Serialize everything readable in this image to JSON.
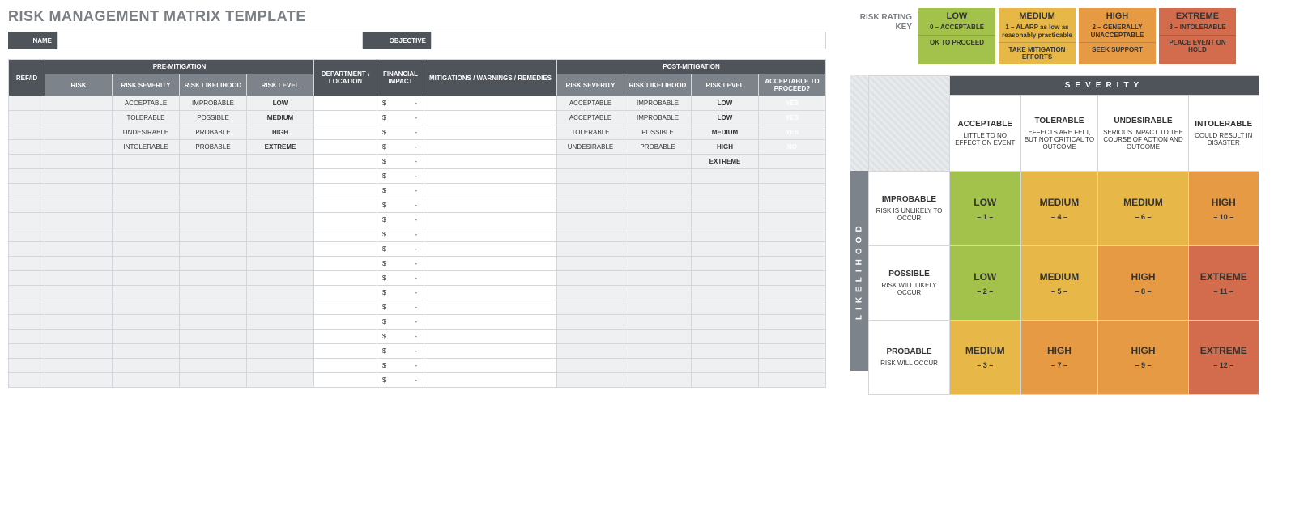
{
  "title": "RISK MANAGEMENT MATRIX TEMPLATE",
  "labels": {
    "name": "NAME",
    "objective": "OBJECTIVE"
  },
  "headers": {
    "refid": "REF/ID",
    "pre": "PRE-MITIGATION",
    "risk": "RISK",
    "sev": "RISK SEVERITY",
    "like": "RISK LIKELIHOOD",
    "level": "RISK LEVEL",
    "dept": "DEPARTMENT / LOCATION",
    "fin": "FINANCIAL IMPACT",
    "mit": "MITIGATIONS / WARNINGS / REMEDIES",
    "post": "POST-MITIGATION",
    "proc": "ACCEPTABLE TO PROCEED?"
  },
  "fin_prefix": "$",
  "fin_dash": "-",
  "rows": [
    {
      "pre_sev": "ACCEPTABLE",
      "pre_sev_cls": "acc",
      "pre_like": "IMPROBABLE",
      "pre_like_cls": "imp",
      "pre_level": "LOW",
      "pre_level_cls": "low",
      "post_sev": "ACCEPTABLE",
      "post_sev_cls": "acc",
      "post_like": "IMPROBABLE",
      "post_like_cls": "imp",
      "post_level": "LOW",
      "post_level_cls": "low",
      "proc": "YES",
      "proc_cls": "yes"
    },
    {
      "pre_sev": "TOLERABLE",
      "pre_sev_cls": "tol",
      "pre_like": "POSSIBLE",
      "pre_like_cls": "pos",
      "pre_level": "MEDIUM",
      "pre_level_cls": "med",
      "post_sev": "ACCEPTABLE",
      "post_sev_cls": "acc",
      "post_like": "IMPROBABLE",
      "post_like_cls": "imp",
      "post_level": "LOW",
      "post_level_cls": "low",
      "proc": "YES",
      "proc_cls": "yes"
    },
    {
      "pre_sev": "UNDESIRABLE",
      "pre_sev_cls": "und",
      "pre_like": "PROBABLE",
      "pre_like_cls": "prob",
      "pre_level": "HIGH",
      "pre_level_cls": "high",
      "post_sev": "TOLERABLE",
      "post_sev_cls": "tol",
      "post_like": "POSSIBLE",
      "post_like_cls": "pos",
      "post_level": "MEDIUM",
      "post_level_cls": "med",
      "proc": "YES",
      "proc_cls": "yes"
    },
    {
      "pre_sev": "INTOLERABLE",
      "pre_sev_cls": "intol",
      "pre_like": "PROBABLE",
      "pre_like_cls": "prob",
      "pre_level": "EXTREME",
      "pre_level_cls": "ext",
      "post_sev": "UNDESIRABLE",
      "post_sev_cls": "und",
      "post_like": "PROBABLE",
      "post_like_cls": "prob",
      "post_level": "HIGH",
      "post_level_cls": "high",
      "proc": "NO",
      "proc_cls": "no"
    },
    {
      "post_level": "EXTREME",
      "post_level_cls": "ext"
    },
    {},
    {},
    {},
    {},
    {},
    {},
    {},
    {},
    {},
    {},
    {},
    {},
    {},
    {},
    {}
  ],
  "key": {
    "title": "RISK RATING KEY",
    "items": [
      {
        "cls": "kb-low",
        "big": "LOW",
        "sub": "0 – ACCEPTABLE",
        "bot": "OK TO PROCEED"
      },
      {
        "cls": "kb-med",
        "big": "MEDIUM",
        "sub": "1 – ALARP as low as reasonably practicable",
        "bot": "TAKE MITIGATION EFFORTS"
      },
      {
        "cls": "kb-high",
        "big": "HIGH",
        "sub": "2 – GENERALLY UNACCEPTABLE",
        "bot": "SEEK SUPPORT"
      },
      {
        "cls": "kb-ext",
        "big": "EXTREME",
        "sub": "3 – INTOLERABLE",
        "bot": "PLACE EVENT ON HOLD"
      }
    ]
  },
  "matrix": {
    "sev_label": "SEVERITY",
    "like_label": "LIKELIHOOD",
    "cols": [
      {
        "big": "ACCEPTABLE",
        "sub": "LITTLE TO NO EFFECT ON EVENT"
      },
      {
        "big": "TOLERABLE",
        "sub": "EFFECTS ARE FELT, BUT NOT CRITICAL TO OUTCOME"
      },
      {
        "big": "UNDESIRABLE",
        "sub": "SERIOUS IMPACT TO THE COURSE OF ACTION AND OUTCOME"
      },
      {
        "big": "INTOLERABLE",
        "sub": "COULD RESULT IN DISASTER"
      }
    ],
    "rows": [
      {
        "big": "IMPROBABLE",
        "sub": "RISK IS UNLIKELY TO OCCUR",
        "cells": [
          {
            "cls": "low",
            "big": "LOW",
            "n": "– 1 –"
          },
          {
            "cls": "med",
            "big": "MEDIUM",
            "n": "– 4 –"
          },
          {
            "cls": "med",
            "big": "MEDIUM",
            "n": "– 6 –"
          },
          {
            "cls": "high",
            "big": "HIGH",
            "n": "– 10 –"
          }
        ]
      },
      {
        "big": "POSSIBLE",
        "sub": "RISK WILL LIKELY OCCUR",
        "cells": [
          {
            "cls": "low",
            "big": "LOW",
            "n": "– 2 –"
          },
          {
            "cls": "med",
            "big": "MEDIUM",
            "n": "– 5 –"
          },
          {
            "cls": "high",
            "big": "HIGH",
            "n": "– 8 –"
          },
          {
            "cls": "ext",
            "big": "EXTREME",
            "n": "– 11 –"
          }
        ]
      },
      {
        "big": "PROBABLE",
        "sub": "RISK WILL OCCUR",
        "cells": [
          {
            "cls": "med",
            "big": "MEDIUM",
            "n": "– 3 –"
          },
          {
            "cls": "high",
            "big": "HIGH",
            "n": "– 7 –"
          },
          {
            "cls": "high",
            "big": "HIGH",
            "n": "– 9 –"
          },
          {
            "cls": "ext",
            "big": "EXTREME",
            "n": "– 12 –"
          }
        ]
      }
    ]
  }
}
